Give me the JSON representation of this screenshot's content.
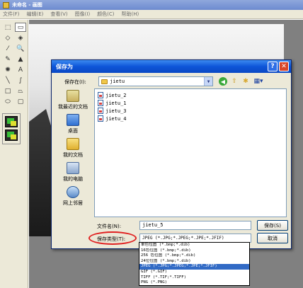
{
  "paint": {
    "title": "未命名 - 画图",
    "menu": [
      "文件(F)",
      "编辑(E)",
      "查看(V)",
      "图像(I)",
      "颜色(C)",
      "帮助(H)"
    ],
    "tools": [
      {
        "name": "free-select-tool",
        "glyph": "⬚"
      },
      {
        "name": "rect-select-tool",
        "glyph": "▭"
      },
      {
        "name": "eraser-tool",
        "glyph": "◇"
      },
      {
        "name": "fill-tool",
        "glyph": "◈"
      },
      {
        "name": "color-picker-tool",
        "glyph": "⁄"
      },
      {
        "name": "magnifier-tool",
        "glyph": "🔍"
      },
      {
        "name": "pencil-tool",
        "glyph": "✎"
      },
      {
        "name": "brush-tool",
        "glyph": "▲"
      },
      {
        "name": "airbrush-tool",
        "glyph": "✺"
      },
      {
        "name": "text-tool",
        "glyph": "A"
      },
      {
        "name": "line-tool",
        "glyph": "╲"
      },
      {
        "name": "curve-tool",
        "glyph": "∫"
      },
      {
        "name": "rectangle-tool",
        "glyph": "□"
      },
      {
        "name": "polygon-tool",
        "glyph": "⏢"
      },
      {
        "name": "ellipse-tool",
        "glyph": "⬭"
      },
      {
        "name": "rounded-rect-tool",
        "glyph": "▢"
      }
    ]
  },
  "dialog": {
    "title": "保存为",
    "help_glyph": "?",
    "close_glyph": "✕",
    "save_in_label": "保存在(I):",
    "save_in_value": "jietu",
    "places": [
      {
        "label": "我最近的文档",
        "icon": "recent-documents-icon",
        "cls": "pi-recent"
      },
      {
        "label": "桌面",
        "icon": "desktop-icon",
        "cls": "pi-desktop"
      },
      {
        "label": "我的文档",
        "icon": "my-documents-icon",
        "cls": "pi-docs"
      },
      {
        "label": "我的电脑",
        "icon": "my-computer-icon",
        "cls": "pi-computer"
      },
      {
        "label": "网上邻居",
        "icon": "network-places-icon",
        "cls": "pi-network"
      }
    ],
    "files": [
      "jietu_2",
      "jietu_1",
      "jietu_3",
      "jietu_4"
    ],
    "filename_label": "文件名(N):",
    "filename_value": "jietu_5",
    "filetype_label": "保存类型(T):",
    "filetype_value": "JPEG (*.JPG;*.JPEG;*.JPE;*.JFIF)",
    "save_button": "保存(S)",
    "cancel_button": "取消",
    "filetype_options": [
      "单色位图 (*.bmp;*.dib)",
      "16色位图 (*.bmp;*.dib)",
      "256 色位图 (*.bmp;*.dib)",
      "24位位图 (*.bmp;*.dib)",
      "JPEG (*.JPG;*.JPEG;*.JPE;*.JFIF)",
      "GIF (*.GIF)",
      "TIFF (*.TIF;*.TIFF)",
      "PNG (*.PNG)"
    ],
    "selected_option_index": 4
  }
}
